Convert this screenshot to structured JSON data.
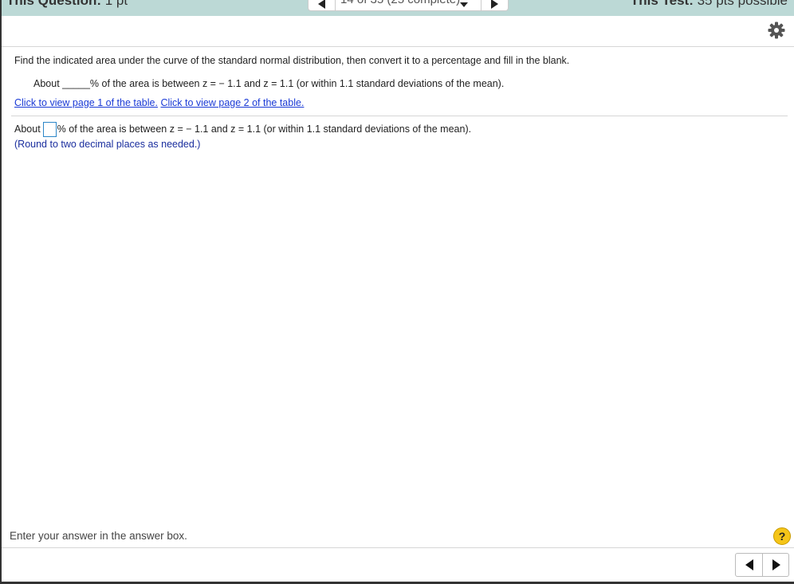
{
  "header": {
    "question_label": "This Question:",
    "question_points": "1 pt",
    "progress": "14 of 35 (25 complete)",
    "test_label": "This Test:",
    "test_points": "35 pts possible",
    "band_color": "#bcd9d6"
  },
  "icons": {
    "settings": "gear-icon",
    "help": "question-mark-icon",
    "prev": "triangle-left-icon",
    "next": "triangle-right-icon",
    "dropdown": "caret-down-icon"
  },
  "question": {
    "instruction": "Find the indicated area under the curve of the standard normal distribution, then convert it to a percentage and fill in the blank.",
    "statement": "About _____% of the area is between z = − 1.1 and z = 1.1 (or within 1.1 standard deviations of the mean).",
    "link1": "Click to view page 1 of the table.",
    "link2": "Click to view page 2 of the table."
  },
  "answer": {
    "prefix": "About",
    "value": "",
    "suffix": "% of the area is between z = − 1.1 and z = 1.1 (or within 1.1 standard deviations of the mean).",
    "hint": "(Round to two decimal places as needed.)"
  },
  "footer": {
    "message": "Enter your answer in the answer box.",
    "help_symbol": "?"
  },
  "colors": {
    "link": "#1a3ad6",
    "hint": "#1a2e9e",
    "input_border": "#2c86c8",
    "help_bg": "#f5c518"
  }
}
